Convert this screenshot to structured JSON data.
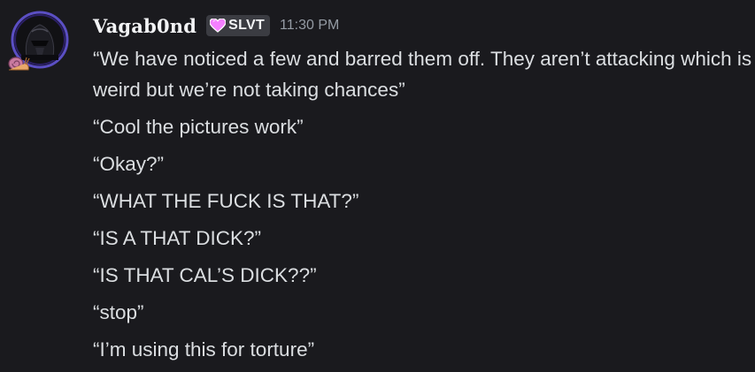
{
  "message": {
    "author": "Vagab0nd",
    "tag": "SLVT",
    "timestamp": "11:30 PM",
    "lines": [
      "“We have noticed a few and barred them off. They aren’t attacking which is weird but we’re not taking chances”",
      "“Cool the pictures work”",
      "“Okay?”",
      "“WHAT THE FUCK IS THAT?”",
      "“IS A THAT DICK?”",
      "“IS THAT CAL’S DICK??”",
      "“stop”",
      "“I’m using this for torture”"
    ]
  },
  "icons": {
    "avatar": "avatar-dark-helmet",
    "avatar_decoration": "snail-icon",
    "tag_icon": "pink-heart-icon"
  },
  "colors": {
    "background": "#1a1a1e",
    "username": "#f2f3f5",
    "message_text": "#dbdee1",
    "timestamp": "#949ba4",
    "tag_background": "#3b3c42",
    "avatar_ring": "#5b4fc4",
    "heart": "#f47fff"
  }
}
